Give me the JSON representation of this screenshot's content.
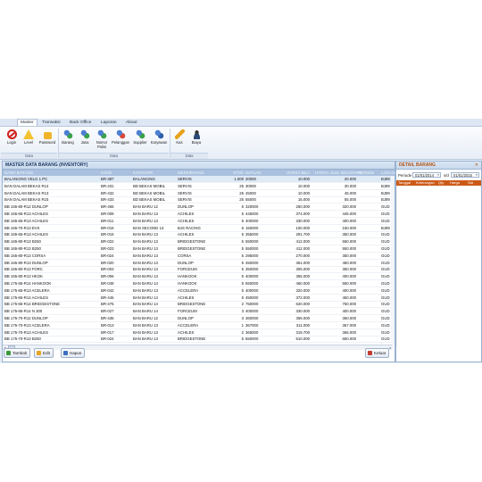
{
  "ribbon": {
    "tabs": [
      "Master",
      "Transaksi",
      "Back Office",
      "Laporan",
      "About"
    ],
    "buttons": [
      {
        "label": "Login",
        "icon": "no-entry-icon"
      },
      {
        "label": "Level",
        "icon": "warning-icon"
      },
      {
        "label": "Password",
        "icon": "key-icon"
      },
      {
        "label": "Barang",
        "icon": "users-icon"
      },
      {
        "label": "Jasa",
        "icon": "users-icon"
      },
      {
        "label": "Nomor Polisi",
        "icon": "users-icon"
      },
      {
        "label": "Pelanggan",
        "icon": "users-icon"
      },
      {
        "label": "Supplier",
        "icon": "users-icon"
      },
      {
        "label": "Karyawan",
        "icon": "users-icon"
      },
      {
        "label": "Kas",
        "icon": "pencil-icon"
      },
      {
        "label": "Biaya",
        "icon": "person-icon"
      }
    ],
    "groups": [
      "Data",
      "Data",
      "Data"
    ]
  },
  "master": {
    "title": "MASTER DATA BARANG (INVENTORY)",
    "columns": [
      "NAMA BARANG",
      "KODE",
      "KATEGORI",
      "MERK/BAHAN",
      "STOK",
      "SATUAN",
      "HARGA BELI",
      "HARGA JUAL SEKARANG",
      "PERSEN",
      "LOKASI"
    ],
    "rows": [
      [
        "BALANCING VELG 1 PC",
        "BR-387",
        "BALANCING",
        "SERVIS",
        "1.000",
        "20000",
        "10.000",
        "20.000",
        "",
        "BJ89"
      ],
      [
        "BAN DALAM BEKAS R14",
        "BR-431",
        "BD BEKAS MOBIL",
        "SERVIS",
        "25",
        "30000",
        "10.000",
        "30.000",
        "",
        "BJ89"
      ],
      [
        "BAN DALAM BEKAS R13",
        "BR-432",
        "BD BEKAS MOBIL",
        "SERVIS",
        "25",
        "45000",
        "10.000",
        "45.000",
        "",
        "BJ89"
      ],
      [
        "BAN DALAM BEKAS R15",
        "BR-433",
        "BD BEKAS MOBIL",
        "SERVIS",
        "25",
        "55000",
        "15.000",
        "55.000",
        "",
        "BJ89"
      ],
      [
        "BB 155-80-R12 DUNLOP",
        "BR-465",
        "BAN BARU 12",
        "DUNLOP",
        "6",
        "320000",
        "260.000",
        "320.000",
        "",
        "GUD"
      ],
      [
        "BB 165-65-R13 ACHILES",
        "BR-009",
        "BAN BARU 13",
        "ACHILES",
        "5",
        "445000",
        "374.000",
        "445.000",
        "",
        "GUD"
      ],
      [
        "BB 165-65-R13 ACHILES",
        "BR-011",
        "BAN BARU 13",
        "ACHILES",
        "5",
        "400000",
        "330.000",
        "400.000",
        "",
        "GUD"
      ],
      [
        "BB 165-70-R13 EVS",
        "BR-015",
        "BAN SECOND 13",
        "BJS RACING",
        "5",
        "150000",
        "100.000",
        "150.000",
        "",
        "BJ89"
      ],
      [
        "BB 165-65-R13 ACHILES",
        "BR-015",
        "BAN BARU 13",
        "ACHILES",
        "5",
        "355000",
        "291.700",
        "350.000",
        "",
        "GUD"
      ],
      [
        "BB 165-80-R13 B250",
        "BR-022",
        "BAN BARU 13",
        "BRIDGESTONE",
        "5",
        "550000",
        "412.000",
        "550.000",
        "",
        "GUD"
      ],
      [
        "BB 165-80-R13 B250",
        "BR-023",
        "BAN BARU 13",
        "BRIDGESTONE",
        "5",
        "550000",
        "412.000",
        "550.000",
        "",
        "GUD"
      ],
      [
        "BB 165-80-R13 CORSA",
        "BR-024",
        "BAN BARU 13",
        "CORSA",
        "5",
        "295000",
        "270.000",
        "350.000",
        "",
        "GUD"
      ],
      [
        "BB 165-80-R13 DUNLOP",
        "BR-020",
        "BAN BARU 13",
        "DUNLOP",
        "5",
        "450000",
        "361.000",
        "450.000",
        "",
        "GUD"
      ],
      [
        "BB 165-80-R13 FORC",
        "BR-003",
        "BAN BARU 13",
        "FORCEUM",
        "5",
        "350000",
        "305.000",
        "350.000",
        "",
        "GUD"
      ],
      [
        "BB 165-80-R13 HKOK",
        "BR-006",
        "BAN BARU 13",
        "HANKOOK",
        "5",
        "400000",
        "355.000",
        "400.000",
        "",
        "GUD"
      ],
      [
        "BB 175-65-R14 HANKOOK",
        "BR-048",
        "BAN BARU 14",
        "HANKOOK",
        "5",
        "550000",
        "460.000",
        "550.000",
        "",
        "GUD"
      ],
      [
        "BB 175-65-R13 ACELERA",
        "BR-042",
        "BAN BARU 13",
        "ACCELERA",
        "5",
        "400000",
        "320.000",
        "400.000",
        "",
        "GUD"
      ],
      [
        "BB 175-65-R14 ACHILES",
        "BR-445",
        "BAN BARU 14",
        "ACHILES",
        "5",
        "450000",
        "372.000",
        "450.000",
        "",
        "GUD"
      ],
      [
        "BB 175-65-R14 BRIDGESTONE",
        "BR-476",
        "BAN BARU 14",
        "BRIDGESTONE",
        "2",
        "750000",
        "620.000",
        "750.000",
        "",
        "GUD"
      ],
      [
        "BB 175-65-R14 N 300",
        "BR-027",
        "BAN BARU 14",
        "FORCEUM",
        "3",
        "400000",
        "330.000",
        "400.000",
        "",
        "GUD"
      ],
      [
        "BB 175-70-R12 DUNLOP",
        "BR-435",
        "BAN BARU 12",
        "DUNLOP",
        "3",
        "360000",
        "355.000",
        "360.000",
        "",
        "GUD"
      ],
      [
        "BB 175-70-R13 ACELERA",
        "BR-013",
        "BAN BARU 13",
        "ACCELERA",
        "1",
        "367000",
        "311.000",
        "367.000",
        "",
        "GUD"
      ],
      [
        "BB 175-70-R13 ACHILES",
        "BR-017",
        "BAN BARU 13",
        "ACHILES",
        "2",
        "365000",
        "319.700",
        "365.000",
        "",
        "GUD"
      ],
      [
        "BB 175-70-R13 B250",
        "BR-024",
        "BAN BARU 13",
        "BRIDGESTONE",
        "5",
        "650000",
        "510.000",
        "650.000",
        "",
        "GUD"
      ]
    ],
    "buttons": {
      "add": "Tambah",
      "edit": "Edit",
      "delete": "Hapus",
      "exit": "Keluar"
    }
  },
  "detail": {
    "title": "DETAIL BARANG",
    "periode_label": "Periode",
    "date_from": "01/01/2014",
    "sd_label": "s/d",
    "date_to": "01/01/2015",
    "columns": [
      "Tanggal",
      "Keterangan",
      "Qty",
      "Harga",
      "Sat"
    ]
  },
  "colors": {
    "accent": "#cc5a17",
    "grid_header": "#a9c1de",
    "panel_border": "#99b2d0"
  }
}
